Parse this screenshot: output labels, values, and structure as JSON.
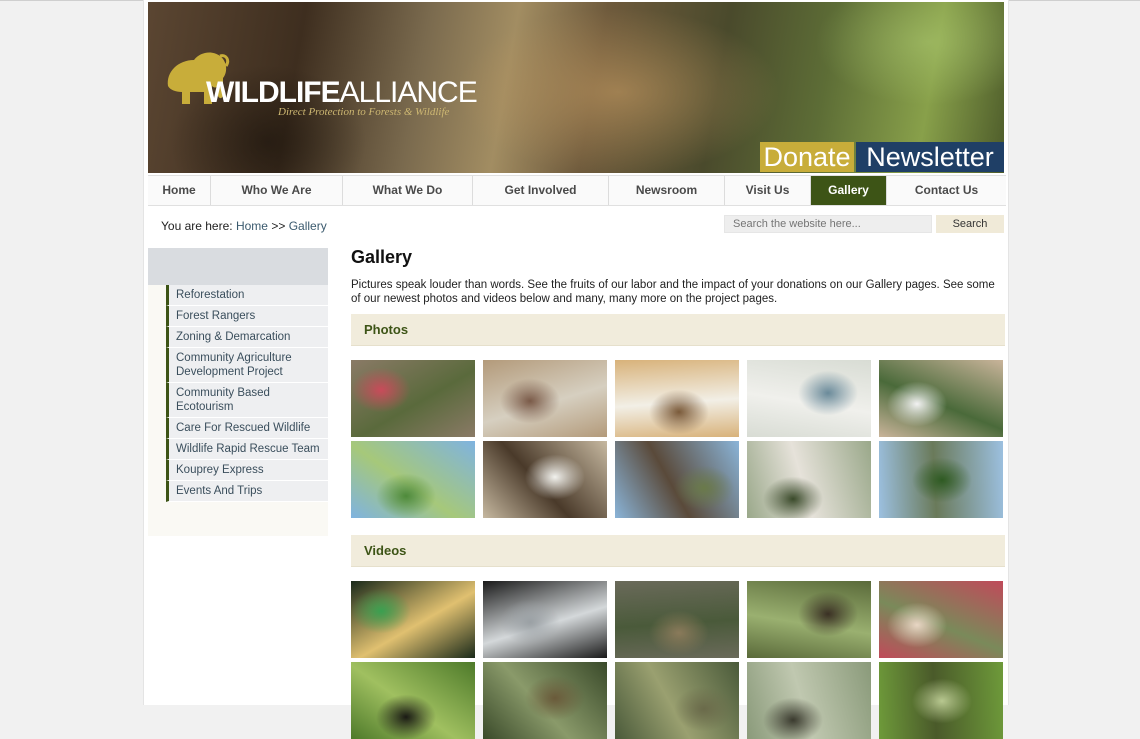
{
  "header": {
    "logo_word_bold": "WILDLIFE",
    "logo_word_light": "ALLIANCE",
    "logo_tagline": "Direct Protection to Forests & Wildlife",
    "donate_label": "Donate",
    "newsletter_label": "Newsletter",
    "colors": {
      "donate_bg": "#c8ad3a",
      "newsletter_bg": "#1f3f66",
      "accent_green": "#3d5416"
    }
  },
  "nav": {
    "items": [
      {
        "label": "Home"
      },
      {
        "label": "Who We Are"
      },
      {
        "label": "What We Do"
      },
      {
        "label": "Get Involved"
      },
      {
        "label": "Newsroom"
      },
      {
        "label": "Visit Us"
      },
      {
        "label": "Gallery",
        "active": true
      },
      {
        "label": "Contact Us"
      }
    ]
  },
  "breadcrumb": {
    "prefix": "You are here:",
    "home": "Home",
    "separator": ">>",
    "current": "Gallery"
  },
  "search": {
    "placeholder": "Search the website here...",
    "button_label": "Search"
  },
  "sidebar": {
    "items": [
      {
        "label": "Reforestation"
      },
      {
        "label": "Forest Rangers"
      },
      {
        "label": "Zoning & Demarcation"
      },
      {
        "label": "Community Agriculture Development Project"
      },
      {
        "label": "Community Based Ecotourism"
      },
      {
        "label": "Care For Rescued Wildlife"
      },
      {
        "label": "Wildlife Rapid Rescue Team"
      },
      {
        "label": "Kouprey Express"
      },
      {
        "label": "Events And Trips"
      }
    ]
  },
  "main": {
    "title": "Gallery",
    "intro": "Pictures speak louder than words. See the fruits of our labor and the impact of your donations on our Gallery pages. See some of our newest photos and videos below and many, many more on the project pages.",
    "photos_heading": "Photos",
    "videos_heading": "Videos",
    "photos": [
      {
        "c1": "#8a7a66",
        "c2": "#c94b5a",
        "c3": "#5a6a3c"
      },
      {
        "c1": "#b39a7a",
        "c2": "#7a5a48",
        "c3": "#d6cfc0"
      },
      {
        "c1": "#d8b27a",
        "c2": "#7a5a3a",
        "c3": "#f2efe6"
      },
      {
        "c1": "#d8dcd4",
        "c2": "#6a8a9a",
        "c3": "#f0f0ec"
      },
      {
        "c1": "#c9b49a",
        "c2": "#f2f2f2",
        "c3": "#4a6a3a"
      },
      {
        "c1": "#7fb3e0",
        "c2": "#4e8a3a",
        "c3": "#a6c87a"
      },
      {
        "c1": "#c6b8a0",
        "c2": "#f2f2ee",
        "c3": "#4a3a2a"
      },
      {
        "c1": "#8ab4d8",
        "c2": "#6a7a4a",
        "c3": "#5a4a3a"
      },
      {
        "c1": "#9aa88a",
        "c2": "#3a4a2a",
        "c3": "#e6e2da"
      },
      {
        "c1": "#9cc0e0",
        "c2": "#2e5a22",
        "c3": "#6a7a5a"
      }
    ],
    "videos": [
      {
        "c1": "#1a2a1a",
        "c2": "#3aa050",
        "c3": "#e0c070"
      },
      {
        "c1": "#1a1a1a",
        "c2": "#9aa0a4",
        "c3": "#d4d8da"
      },
      {
        "c1": "#6a6a5a",
        "c2": "#8a7a5a",
        "c3": "#4a5a3a"
      },
      {
        "c1": "#5a6a3a",
        "c2": "#3a3024",
        "c3": "#9ab070"
      },
      {
        "c1": "#c04a5a",
        "c2": "#e8d6c4",
        "c3": "#7a8a5a"
      },
      {
        "c1": "#4e7a2a",
        "c2": "#1a1a14",
        "c3": "#a0c060"
      },
      {
        "c1": "#3a4a2a",
        "c2": "#6a5a3a",
        "c3": "#8a9a6a"
      },
      {
        "c1": "#4a5a3a",
        "c2": "#6a6a4a",
        "c3": "#9aa070"
      },
      {
        "c1": "#8a9a7a",
        "c2": "#3a3a2e",
        "c3": "#c0c8b0"
      },
      {
        "c1": "#6e9a3a",
        "c2": "#b8c890",
        "c3": "#4a5a2a"
      }
    ]
  }
}
